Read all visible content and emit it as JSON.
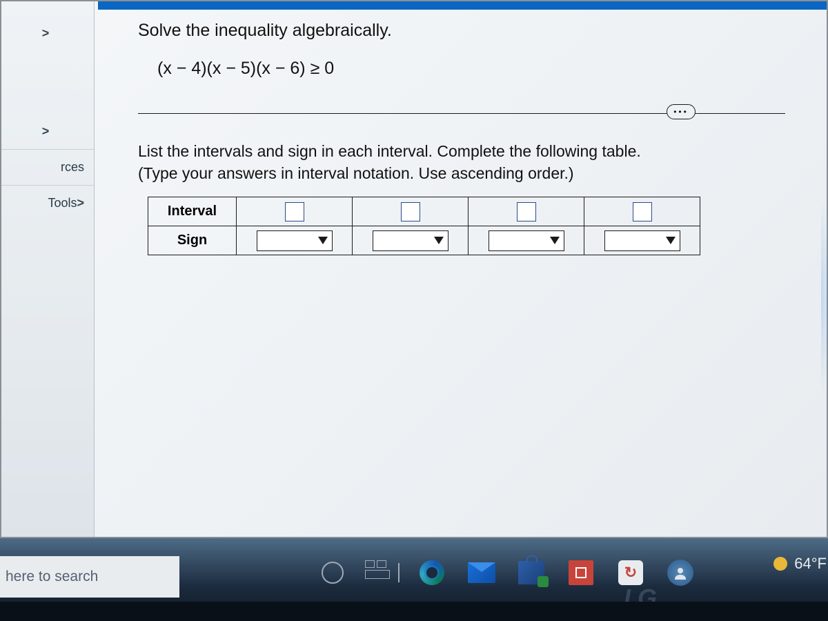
{
  "sidebar": {
    "items": [
      {
        "chev": ">"
      },
      {
        "chev": ">"
      },
      {
        "label": "rces"
      },
      {
        "label": "Tools",
        "chev": ">"
      }
    ]
  },
  "question": {
    "title": "Solve the inequality algebraically.",
    "equation": "(x − 4)(x − 5)(x − 6) ≥ 0"
  },
  "more": "•••",
  "answer": {
    "instr1": "List the intervals and sign in each interval. Complete the following table.",
    "instr2": "(Type your answers in interval notation. Use ascending order.)"
  },
  "table": {
    "row1_label": "Interval",
    "row2_label": "Sign"
  },
  "taskbar": {
    "search": "here to search",
    "weather": "64°F",
    "brand": "LG"
  }
}
